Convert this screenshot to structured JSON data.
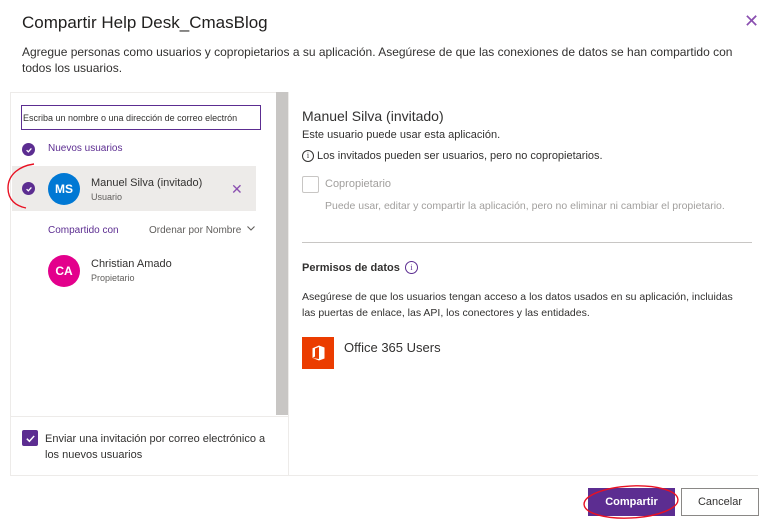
{
  "dialog": {
    "title": "Compartir Help Desk_CmasBlog",
    "description": "Agregue personas como usuarios y copropietarios a su aplicación. Asegúrese de que las conexiones de datos se han compartido con todos los usuarios.",
    "close_icon": "close-icon"
  },
  "left": {
    "search_placeholder": "Escriba un nombre o una dirección de correo electrón",
    "new_users_label": "Nuevos usuarios",
    "new_users": [
      {
        "initials": "MS",
        "name": "Manuel Silva (invitado)",
        "role": "Usuario",
        "avatar_color": "#0078d4",
        "selected": true
      }
    ],
    "shared_with_label": "Compartido con",
    "sort_label": "Ordenar por Nombre",
    "shared_users": [
      {
        "initials": "CA",
        "name": "Christian Amado",
        "role": "Propietario",
        "avatar_color": "#e3008c"
      }
    ],
    "invite_checked": true,
    "invite_label": "Enviar una invitación por correo electrónico a los nuevos usuarios"
  },
  "right": {
    "user_title": "Manuel Silva (invitado)",
    "user_subtitle": "Este usuario puede usar esta aplicación.",
    "guest_info": "Los invitados pueden ser usuarios, pero no copropietarios.",
    "coowner_label": "Copropietario",
    "coowner_checked": false,
    "coowner_desc": "Puede usar, editar y compartir la aplicación, pero no eliminar ni cambiar el propietario.",
    "data_perm_title": "Permisos de datos",
    "data_perm_desc": "Asegúrese de que los usuarios tengan acceso a los datos usados en su aplicación, incluidas las puertas de enlace, las API, los conectores y las entidades.",
    "connector_name": "Office 365 Users",
    "connector_icon": "office-icon"
  },
  "footer": {
    "share_label": "Compartir",
    "cancel_label": "Cancelar"
  },
  "colors": {
    "accent": "#5c2d91",
    "annotation": "#e81123",
    "office": "#eb3c00"
  }
}
